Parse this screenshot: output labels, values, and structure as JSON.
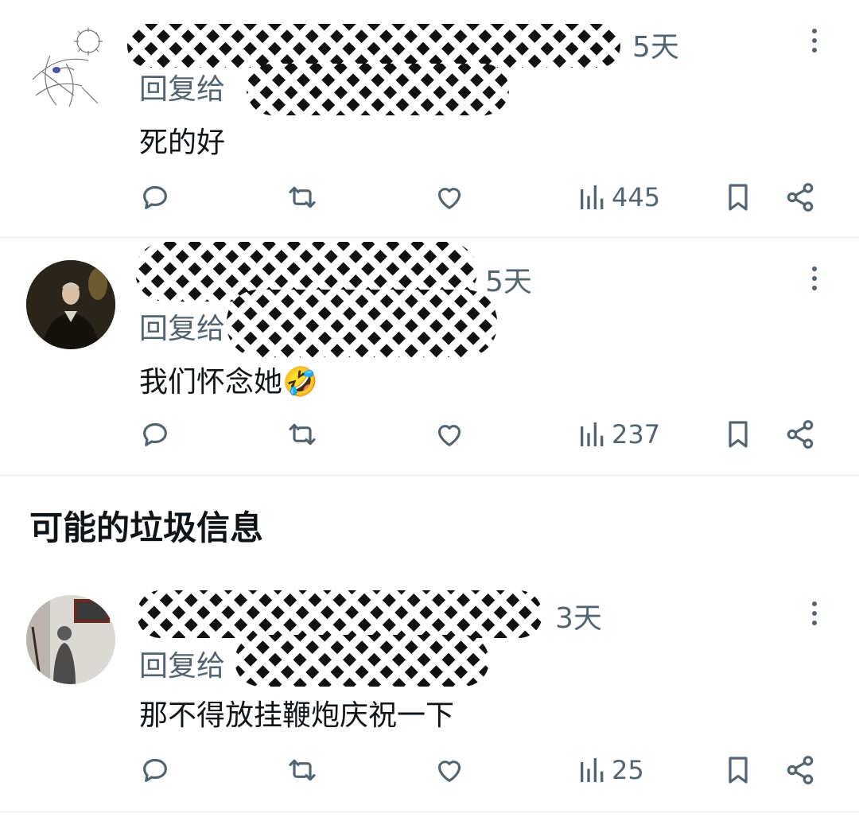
{
  "section": {
    "heading": "可能的垃圾信息"
  },
  "tweets": [
    {
      "time": "5天",
      "reply_prefix": "回复给",
      "content": "死的好",
      "views": "445"
    },
    {
      "time": "5天",
      "reply_prefix": "回复给",
      "content": "我们怀念她🤣",
      "views": "237"
    },
    {
      "time": "3天",
      "reply_prefix": "回复给",
      "content": "那不得放挂鞭炮庆祝一下",
      "views": "25"
    }
  ],
  "colors": {
    "text": "#0f1419",
    "muted": "#536471",
    "divider": "#e6e8eb"
  },
  "icons": [
    "reply-icon",
    "retweet-icon",
    "like-icon",
    "views-icon",
    "bookmark-icon",
    "share-icon",
    "more-icon"
  ]
}
